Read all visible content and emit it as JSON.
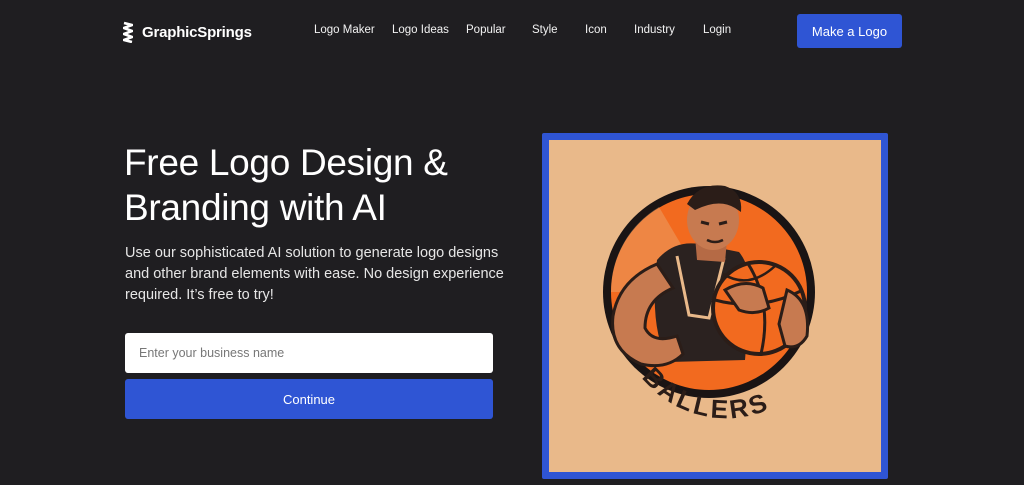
{
  "brand": {
    "name": "GraphicSprings",
    "icon": "spring-icon"
  },
  "nav": {
    "items": [
      {
        "label": "Logo Maker"
      },
      {
        "label": "Logo Ideas"
      },
      {
        "label": "Popular"
      },
      {
        "label": "Style"
      },
      {
        "label": "Icon"
      },
      {
        "label": "Industry"
      },
      {
        "label": "Login"
      }
    ],
    "cta_label": "Make a Logo"
  },
  "hero": {
    "title": "Free Logo Design & Branding with AI",
    "description": "Use our sophisticated AI solution to generate logo designs and other brand elements with ease. No design experience required. It’s free to try!",
    "input_placeholder": "Enter your business name",
    "input_value": "",
    "continue_label": "Continue"
  },
  "showcase": {
    "logo_text": "BALLERS",
    "frame_color": "#2f55d4",
    "background_color": "#e9b98a",
    "accent_color": "#f26a1f"
  },
  "colors": {
    "page_bg": "#1f1e21",
    "primary": "#2f55d4"
  }
}
